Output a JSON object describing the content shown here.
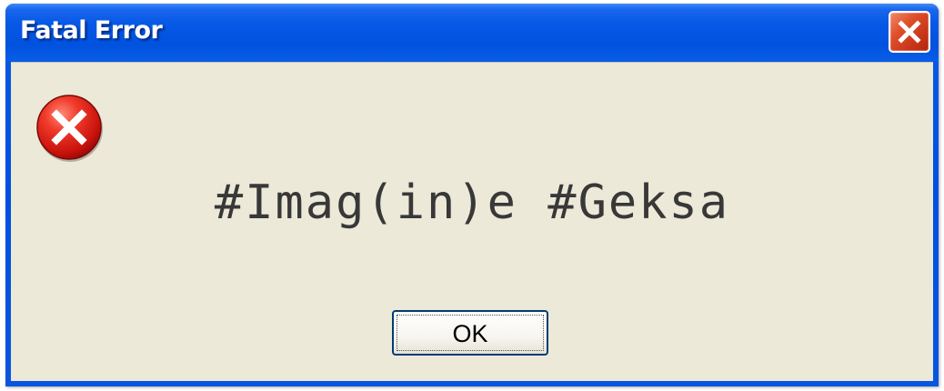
{
  "window": {
    "title": "Fatal Error",
    "close_icon": "close-icon"
  },
  "dialog": {
    "icon": "error-icon",
    "message": "#Imag(in)e #Geksa",
    "ok_label": "OK"
  },
  "colors": {
    "titlebar": "#0052df",
    "client_bg": "#ece9d8",
    "close_button": "#d9441f",
    "error_icon": "#e02020",
    "message_text": "#383838",
    "ok_border": "#003c74"
  }
}
